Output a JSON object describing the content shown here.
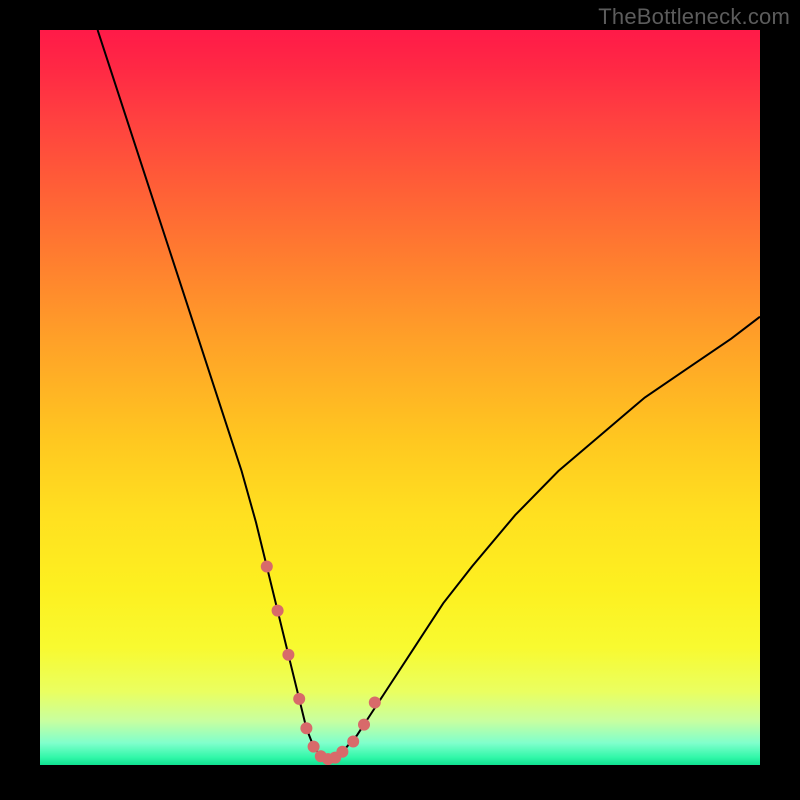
{
  "watermark": "TheBottleneck.com",
  "chart_data": {
    "type": "line",
    "title": "",
    "xlabel": "",
    "ylabel": "",
    "xlim": [
      0,
      100
    ],
    "ylim": [
      0,
      100
    ],
    "grid": false,
    "legend": false,
    "background_gradient": {
      "direction": "vertical",
      "stops": [
        {
          "pos": 0,
          "color": "#ff1a48"
        },
        {
          "pos": 50,
          "color": "#ffc820"
        },
        {
          "pos": 85,
          "color": "#f8fa30"
        },
        {
          "pos": 100,
          "color": "#10e090"
        }
      ]
    },
    "series": [
      {
        "name": "bottleneck-curve",
        "stroke": "#000000",
        "stroke_width": 2,
        "x": [
          8,
          10,
          12,
          14,
          16,
          18,
          20,
          22,
          24,
          26,
          28,
          30,
          31.5,
          33,
          34.5,
          36,
          37,
          38,
          39,
          40,
          41,
          42,
          44,
          46,
          48,
          52,
          56,
          60,
          66,
          72,
          78,
          84,
          90,
          96,
          100
        ],
        "y": [
          100,
          94,
          88,
          82,
          76,
          70,
          64,
          58,
          52,
          46,
          40,
          33,
          27,
          21,
          15,
          9,
          5,
          2.5,
          1.2,
          0.8,
          1.0,
          1.8,
          4,
          7,
          10,
          16,
          22,
          27,
          34,
          40,
          45,
          50,
          54,
          58,
          61
        ]
      },
      {
        "name": "highlight-dots",
        "stroke": "#d86a6a",
        "marker": "circle",
        "marker_radius": 6,
        "x": [
          31.5,
          33,
          34.5,
          36,
          37,
          38,
          39,
          40,
          41,
          42,
          43.5,
          45,
          46.5
        ],
        "y": [
          27,
          21,
          15,
          9,
          5,
          2.5,
          1.2,
          0.8,
          1.0,
          1.8,
          3.2,
          5.5,
          8.5
        ]
      }
    ]
  }
}
